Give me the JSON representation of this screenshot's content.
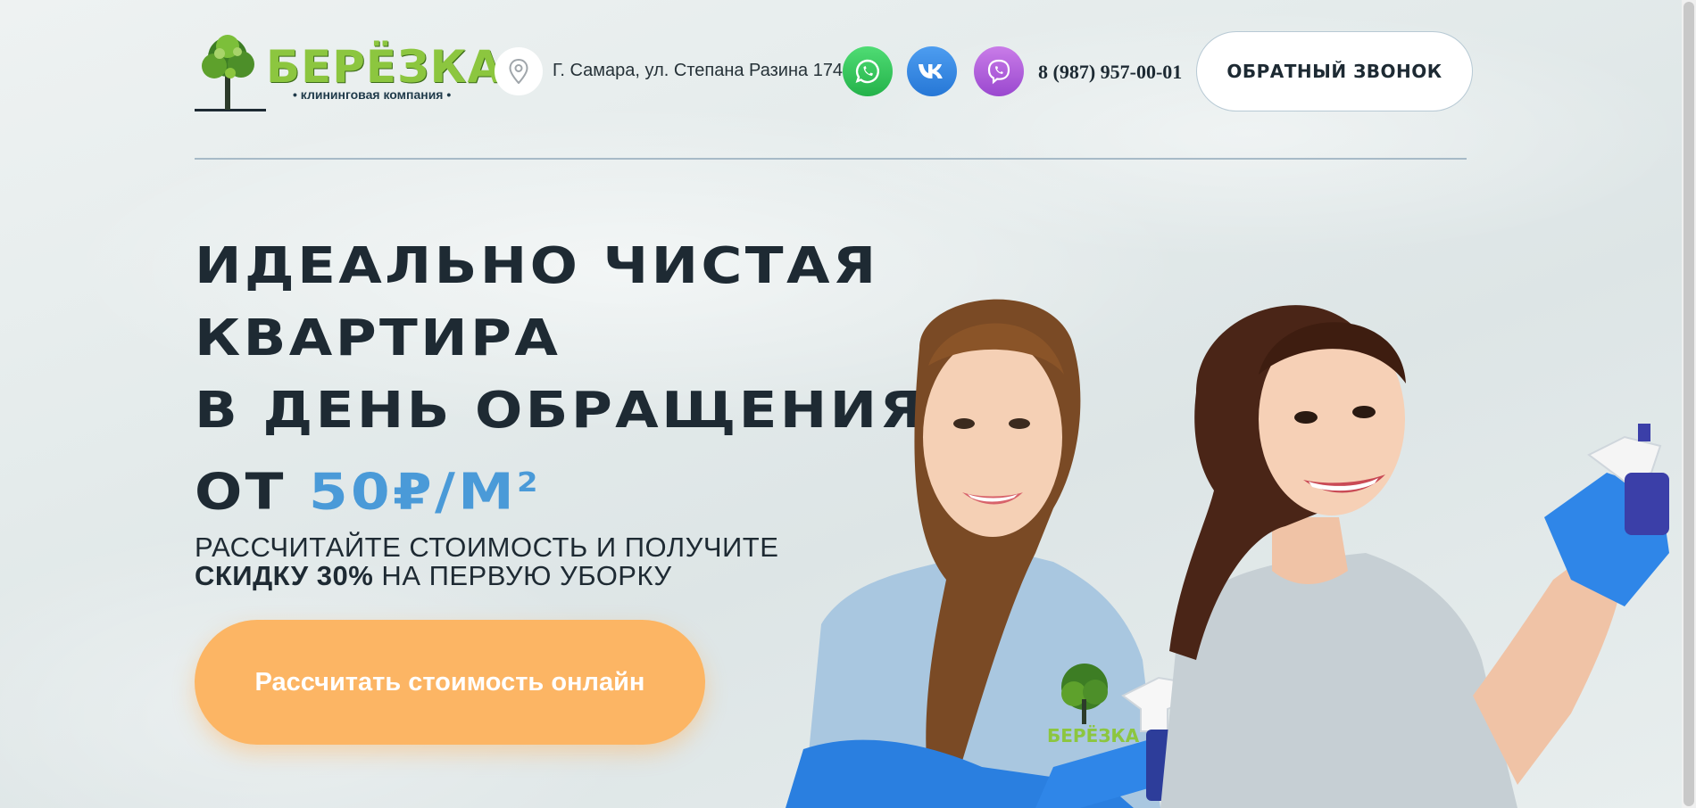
{
  "header": {
    "logo": {
      "name": "БЕРЁЗКА",
      "tagline": "• клининговая компания •",
      "subline": ""
    },
    "address": "Г. Самара, ул. Степана Разина 174",
    "phone": "8 (987) 957-00-01",
    "callback_label": "ОБРАТНЫЙ ЗВОНОК",
    "socials": [
      {
        "name": "whatsapp",
        "icon": "whatsapp-icon",
        "color": "#25d366"
      },
      {
        "name": "vk",
        "icon": "vk-icon",
        "color": "#2787f5"
      },
      {
        "name": "viber",
        "icon": "viber-icon",
        "color": "#a855d4"
      }
    ]
  },
  "hero": {
    "headline_lines": [
      "ИДЕАЛЬНО ЧИСТАЯ",
      "КВАРТИРА",
      "В ДЕНЬ ОБРАЩЕНИЯ"
    ],
    "price_prefix": "ОТ ",
    "price_value": "50₽/М",
    "price_sup": "2",
    "subhead_line1": "РАССЧИТАЙТЕ СТОИМОСТЬ И ПОЛУЧИТЕ",
    "subhead_bold": "СКИДКУ 30%",
    "subhead_rest": " НА ПЕРВУЮ УБОРКУ",
    "cta_label": "Рассчитать стоимость онлайн",
    "shirt_logo": "БЕРЁЗКА"
  },
  "colors": {
    "accent_blue": "#4a9ad8",
    "cta_orange": "#fcb564",
    "logo_green": "#8cc63f",
    "text_dark": "#1e2a33"
  }
}
